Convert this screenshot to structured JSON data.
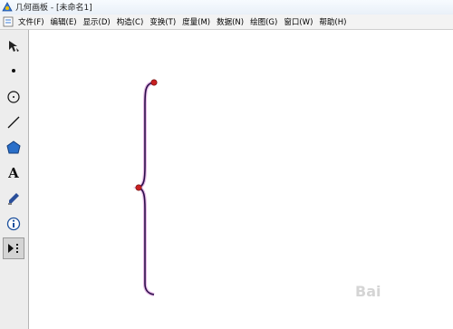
{
  "window": {
    "title": "几何画板 - [未命名1]"
  },
  "menu": {
    "items": [
      {
        "label": "文件(F)"
      },
      {
        "label": "编辑(E)"
      },
      {
        "label": "显示(D)"
      },
      {
        "label": "构造(C)"
      },
      {
        "label": "变换(T)"
      },
      {
        "label": "度量(M)"
      },
      {
        "label": "数据(N)"
      },
      {
        "label": "绘图(G)"
      },
      {
        "label": "窗口(W)"
      },
      {
        "label": "帮助(H)"
      }
    ]
  },
  "toolbar": {
    "tools": [
      {
        "icon": "arrow-select-icon"
      },
      {
        "icon": "point-tool-icon"
      },
      {
        "icon": "compass-circle-icon"
      },
      {
        "icon": "straightedge-icon"
      },
      {
        "icon": "polygon-icon"
      },
      {
        "icon": "text-tool-icon",
        "glyph": "A"
      },
      {
        "icon": "marker-pen-icon"
      },
      {
        "icon": "information-icon"
      },
      {
        "icon": "custom-tool-icon",
        "active": true
      }
    ]
  },
  "colors": {
    "curve": "#2b0f4a",
    "curve_halo": "#e6b8e6",
    "point": "#c82020"
  },
  "watermark": {
    "text": "Bai"
  }
}
